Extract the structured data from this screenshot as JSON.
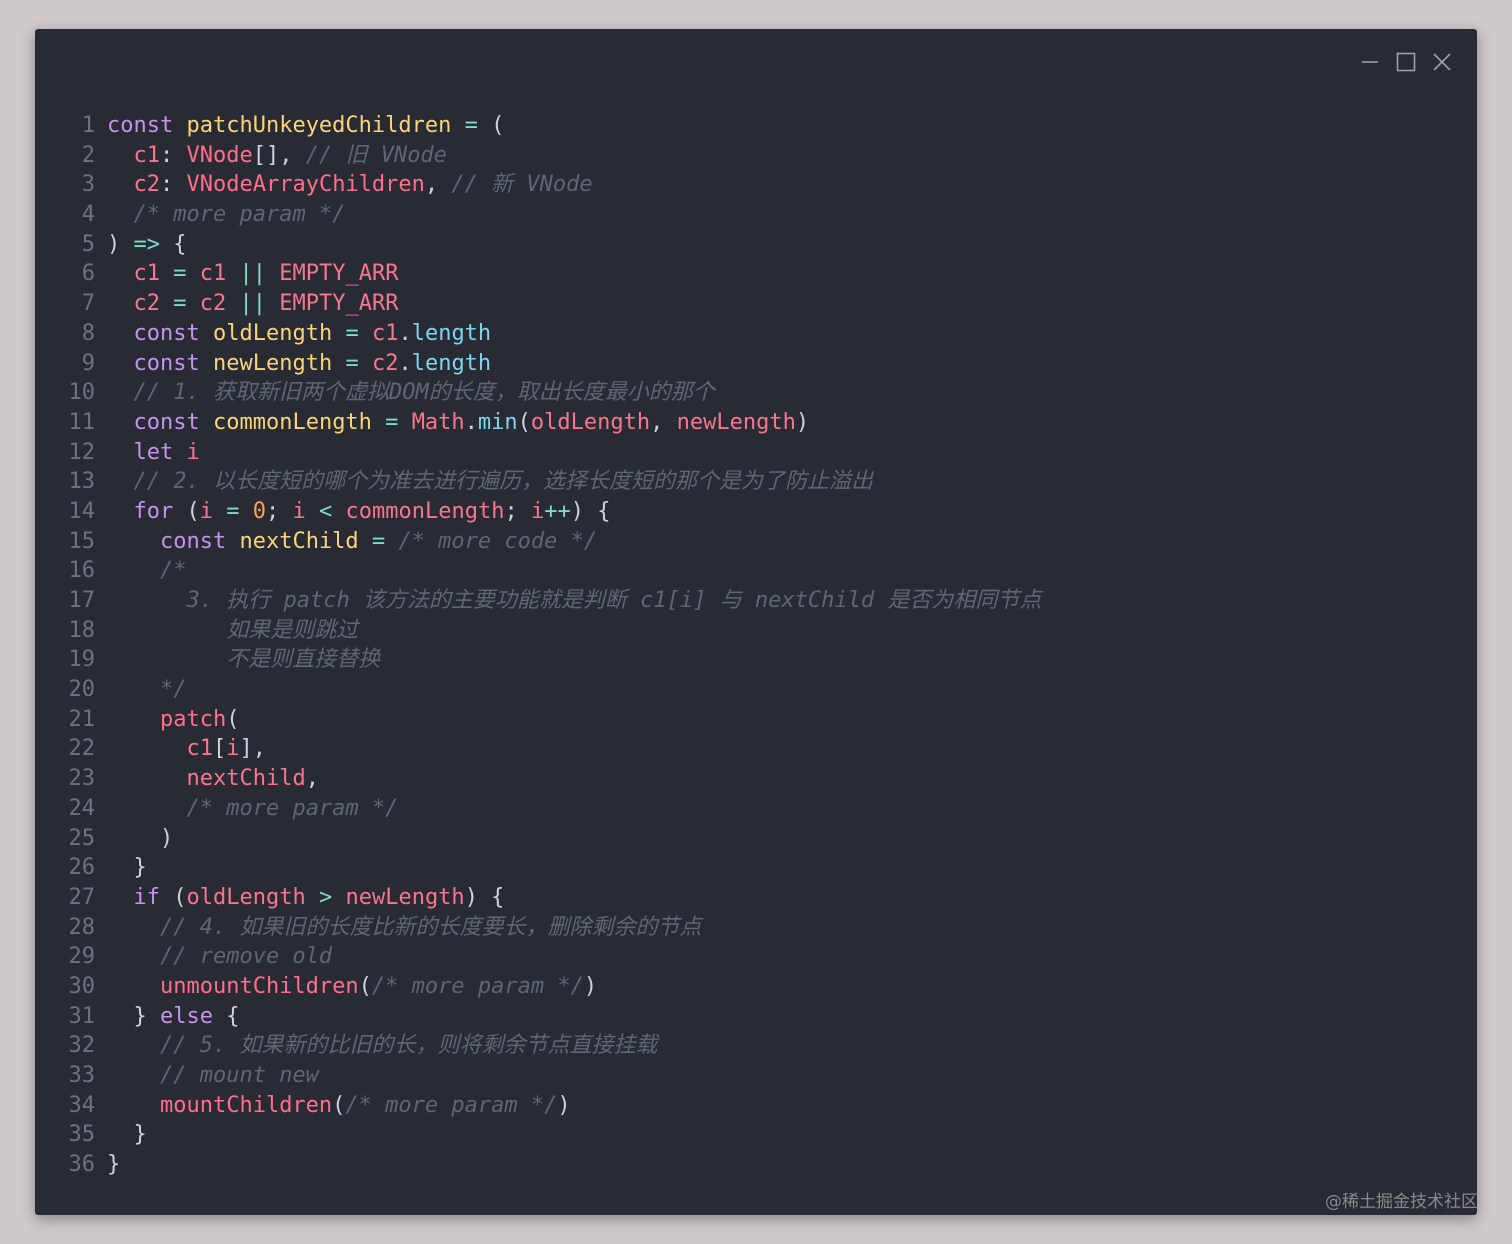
{
  "window": {
    "controls": [
      "minimize",
      "maximize",
      "close"
    ]
  },
  "watermark": "@稀土掘金技术社区",
  "colors": {
    "background": "#cfc9ca",
    "editor": "#282b33",
    "keyword": "#c592ec",
    "function": "#f9d479",
    "variable": "#ff6e8a",
    "operator": "#7fdbca",
    "comment": "#5f6673",
    "property": "#7ed6ee",
    "number": "#f7a35c"
  },
  "code": {
    "lines": [
      [
        [
          "kw",
          "const "
        ],
        [
          "fn",
          "patchUnkeyedChildren"
        ],
        [
          "op",
          " = "
        ],
        [
          "pu",
          "("
        ]
      ],
      [
        [
          "pu",
          "  "
        ],
        [
          "vr",
          "c1"
        ],
        [
          "pu",
          ": "
        ],
        [
          "ty",
          "VNode"
        ],
        [
          "pu",
          "[], "
        ],
        [
          "cm",
          "// 旧 VNode"
        ]
      ],
      [
        [
          "pu",
          "  "
        ],
        [
          "vr",
          "c2"
        ],
        [
          "pu",
          ": "
        ],
        [
          "ty",
          "VNodeArrayChildren"
        ],
        [
          "pu",
          ", "
        ],
        [
          "cm",
          "// 新 VNode"
        ]
      ],
      [
        [
          "pu",
          "  "
        ],
        [
          "cm",
          "/* more param */"
        ]
      ],
      [
        [
          "pu",
          ") "
        ],
        [
          "op",
          "=>"
        ],
        [
          "pu",
          " {"
        ]
      ],
      [
        [
          "pu",
          "  "
        ],
        [
          "vr",
          "c1"
        ],
        [
          "op",
          " = "
        ],
        [
          "vr",
          "c1"
        ],
        [
          "op",
          " || "
        ],
        [
          "vr",
          "EMPTY_ARR"
        ]
      ],
      [
        [
          "pu",
          "  "
        ],
        [
          "vr",
          "c2"
        ],
        [
          "op",
          " = "
        ],
        [
          "vr",
          "c2"
        ],
        [
          "op",
          " || "
        ],
        [
          "vr",
          "EMPTY_ARR"
        ]
      ],
      [
        [
          "pu",
          "  "
        ],
        [
          "kw",
          "const "
        ],
        [
          "fn",
          "oldLength"
        ],
        [
          "op",
          " = "
        ],
        [
          "vr",
          "c1"
        ],
        [
          "pu",
          "."
        ],
        [
          "pr",
          "length"
        ]
      ],
      [
        [
          "pu",
          "  "
        ],
        [
          "kw",
          "const "
        ],
        [
          "fn",
          "newLength"
        ],
        [
          "op",
          " = "
        ],
        [
          "vr",
          "c2"
        ],
        [
          "pu",
          "."
        ],
        [
          "pr",
          "length"
        ]
      ],
      [
        [
          "pu",
          "  "
        ],
        [
          "cm",
          "// 1. 获取新旧两个虚拟DOM的长度，取出长度最小的那个"
        ]
      ],
      [
        [
          "pu",
          "  "
        ],
        [
          "kw",
          "const "
        ],
        [
          "fn",
          "commonLength"
        ],
        [
          "op",
          " = "
        ],
        [
          "vr",
          "Math"
        ],
        [
          "pu",
          "."
        ],
        [
          "pr",
          "min"
        ],
        [
          "pu",
          "("
        ],
        [
          "vr",
          "oldLength"
        ],
        [
          "pu",
          ", "
        ],
        [
          "vr",
          "newLength"
        ],
        [
          "pu",
          ")"
        ]
      ],
      [
        [
          "pu",
          "  "
        ],
        [
          "kw",
          "let "
        ],
        [
          "vr",
          "i"
        ]
      ],
      [
        [
          "pu",
          "  "
        ],
        [
          "cm",
          "// 2. 以长度短的哪个为准去进行遍历，选择长度短的那个是为了防止溢出"
        ]
      ],
      [
        [
          "pu",
          "  "
        ],
        [
          "kw",
          "for"
        ],
        [
          "pu",
          " ("
        ],
        [
          "vr",
          "i"
        ],
        [
          "op",
          " = "
        ],
        [
          "nu",
          "0"
        ],
        [
          "pu",
          "; "
        ],
        [
          "vr",
          "i"
        ],
        [
          "op",
          " < "
        ],
        [
          "vr",
          "commonLength"
        ],
        [
          "pu",
          "; "
        ],
        [
          "vr",
          "i"
        ],
        [
          "op",
          "++"
        ],
        [
          "pu",
          ") {"
        ]
      ],
      [
        [
          "pu",
          "    "
        ],
        [
          "kw",
          "const "
        ],
        [
          "fn",
          "nextChild"
        ],
        [
          "op",
          " = "
        ],
        [
          "cm",
          "/* more code */"
        ]
      ],
      [
        [
          "pu",
          "    "
        ],
        [
          "cm",
          "/*"
        ]
      ],
      [
        [
          "pu",
          "      "
        ],
        [
          "cm",
          "3. 执行 patch 该方法的主要功能就是判断 c1[i] 与 nextChild 是否为相同节点"
        ]
      ],
      [
        [
          "pu",
          "         "
        ],
        [
          "cm",
          "如果是则跳过"
        ]
      ],
      [
        [
          "pu",
          "         "
        ],
        [
          "cm",
          "不是则直接替换"
        ]
      ],
      [
        [
          "pu",
          "    "
        ],
        [
          "cm",
          "*/"
        ]
      ],
      [
        [
          "pu",
          "    "
        ],
        [
          "vr2",
          "patch"
        ],
        [
          "pu",
          "("
        ]
      ],
      [
        [
          "pu",
          "      "
        ],
        [
          "vr",
          "c1"
        ],
        [
          "pu",
          "["
        ],
        [
          "vr",
          "i"
        ],
        [
          "pu",
          "],"
        ]
      ],
      [
        [
          "pu",
          "      "
        ],
        [
          "vr",
          "nextChild"
        ],
        [
          "pu",
          ","
        ]
      ],
      [
        [
          "pu",
          "      "
        ],
        [
          "cm",
          "/* more param */"
        ]
      ],
      [
        [
          "pu",
          "    )"
        ]
      ],
      [
        [
          "pu",
          "  }"
        ]
      ],
      [
        [
          "pu",
          "  "
        ],
        [
          "kw",
          "if"
        ],
        [
          "pu",
          " ("
        ],
        [
          "vr",
          "oldLength"
        ],
        [
          "op",
          " > "
        ],
        [
          "vr",
          "newLength"
        ],
        [
          "pu",
          ") {"
        ]
      ],
      [
        [
          "pu",
          "    "
        ],
        [
          "cm",
          "// 4. 如果旧的长度比新的长度要长，删除剩余的节点"
        ]
      ],
      [
        [
          "pu",
          "    "
        ],
        [
          "cm",
          "// remove old"
        ]
      ],
      [
        [
          "pu",
          "    "
        ],
        [
          "vr2",
          "unmountChildren"
        ],
        [
          "pu",
          "("
        ],
        [
          "cm",
          "/* more param */"
        ],
        [
          "pu",
          ")"
        ]
      ],
      [
        [
          "pu",
          "  } "
        ],
        [
          "kw",
          "else"
        ],
        [
          "pu",
          " {"
        ]
      ],
      [
        [
          "pu",
          "    "
        ],
        [
          "cm",
          "// 5. 如果新的比旧的长，则将剩余节点直接挂载"
        ]
      ],
      [
        [
          "pu",
          "    "
        ],
        [
          "cm",
          "// mount new"
        ]
      ],
      [
        [
          "pu",
          "    "
        ],
        [
          "vr2",
          "mountChildren"
        ],
        [
          "pu",
          "("
        ],
        [
          "cm",
          "/* more param */"
        ],
        [
          "pu",
          ")"
        ]
      ],
      [
        [
          "pu",
          "  }"
        ]
      ],
      [
        [
          "pu",
          "}"
        ]
      ]
    ]
  }
}
